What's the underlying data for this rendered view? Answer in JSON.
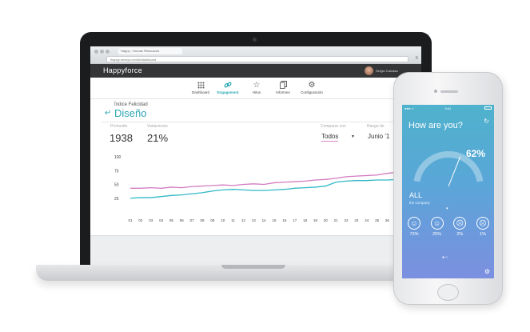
{
  "browser": {
    "tab_title": "Happy - Human Resources",
    "url": "ihappy.nexuys.com/#/dashboard"
  },
  "app": {
    "brand": "Happyforce",
    "user_name": "Sergio Carcasa"
  },
  "nav": {
    "items": [
      {
        "label": "Dashboard",
        "icon": "grid-icon"
      },
      {
        "label": "Engagement",
        "icon": "link-icon",
        "active": true
      },
      {
        "label": "Hitos",
        "icon": "star-icon"
      },
      {
        "label": "Informes",
        "icon": "documents-icon"
      },
      {
        "label": "Configuración",
        "icon": "gear-icon"
      }
    ]
  },
  "dashboard": {
    "subtitle": "Índice Felicidad",
    "team": "Diseño",
    "stats": [
      {
        "label": "Promedio",
        "value": "1938"
      },
      {
        "label": "Variaciones",
        "value": "21%"
      }
    ],
    "compare": {
      "label": "Comparar con",
      "value": "Todos"
    },
    "range": {
      "label": "Rango de",
      "value": "Junio '1"
    }
  },
  "chart_data": {
    "type": "line",
    "x": [
      "01",
      "02",
      "03",
      "04",
      "05",
      "06",
      "07",
      "08",
      "09",
      "10",
      "11",
      "12",
      "13",
      "14",
      "15",
      "16",
      "17",
      "18",
      "19",
      "20",
      "21",
      "22",
      "23",
      "24",
      "25",
      "26",
      "27",
      "28",
      "29"
    ],
    "y_ticks": [
      100,
      75,
      50,
      25
    ],
    "ylim": [
      0,
      100
    ],
    "series": [
      {
        "color": "#d27cc0",
        "values": [
          43,
          43,
          44,
          43,
          45,
          44,
          46,
          47,
          48,
          49,
          48,
          50,
          51,
          50,
          53,
          54,
          55,
          56,
          58,
          59,
          61,
          64,
          65,
          66,
          67,
          70,
          72,
          73,
          75
        ]
      },
      {
        "color": "#30b9c6",
        "values": [
          25,
          26,
          26,
          28,
          30,
          31,
          33,
          35,
          38,
          40,
          41,
          40,
          39,
          39,
          40,
          41,
          43,
          44,
          45,
          47,
          54,
          56,
          57,
          57,
          58,
          58,
          59,
          60,
          59
        ]
      }
    ]
  },
  "phone": {
    "carrier": "●●●○○",
    "time": "9:41",
    "question": "How are you?",
    "percent": "62%",
    "gauge_level": 0.62,
    "group": "ALL",
    "group_sub": "the company",
    "moods": [
      {
        "icon": "very-happy-face-icon",
        "glyph": "☺",
        "pct": "73%"
      },
      {
        "icon": "happy-face-icon",
        "glyph": "☺",
        "pct": "25%"
      },
      {
        "icon": "sad-face-icon",
        "glyph": "☹",
        "pct": "2%"
      },
      {
        "icon": "very-sad-face-icon",
        "glyph": "☹",
        "pct": "1%"
      }
    ],
    "pager": "●○"
  },
  "colors": {
    "accent": "#2ba7b3",
    "header": "#333537",
    "series_pink": "#d27cc0",
    "series_teal": "#30b9c6"
  }
}
